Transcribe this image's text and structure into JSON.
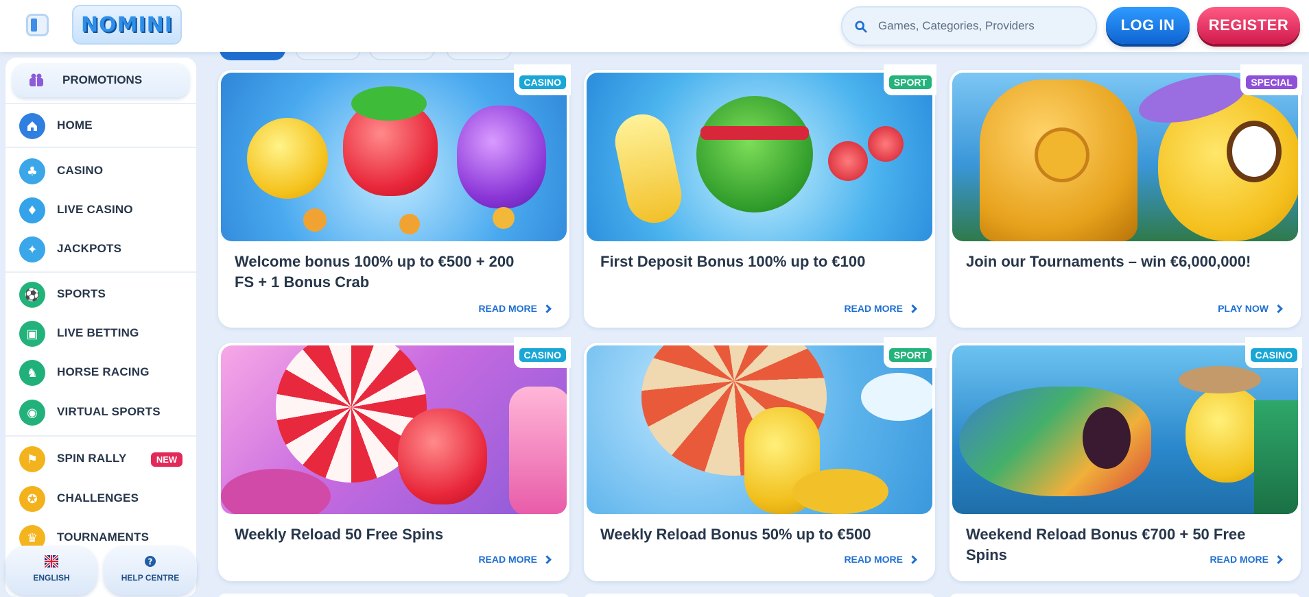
{
  "header": {
    "logo_text": "NOMINI",
    "search_placeholder": "Games, Categories, Providers",
    "login_label": "LOG IN",
    "register_label": "REGISTER"
  },
  "sidebar": {
    "promotions_label": "PROMOTIONS",
    "items": [
      {
        "label": "HOME",
        "icon": "home-icon",
        "color": "#2f7fe0"
      },
      {
        "label": "CASINO",
        "icon": "cards-icon",
        "color": "#3ba6e8"
      },
      {
        "label": "LIVE CASINO",
        "icon": "live-casino-icon",
        "color": "#35a3ea"
      },
      {
        "label": "JACKPOTS",
        "icon": "jackpot-icon",
        "color": "#3aa7ea"
      },
      {
        "label": "SPORTS",
        "icon": "soccer-ball-icon",
        "color": "#22b37a"
      },
      {
        "label": "LIVE BETTING",
        "icon": "live-betting-icon",
        "color": "#24b27c"
      },
      {
        "label": "HORSE RACING",
        "icon": "horse-icon",
        "color": "#20b07a"
      },
      {
        "label": "VIRTUAL SPORTS",
        "icon": "virtual-sports-icon",
        "color": "#23b17b"
      },
      {
        "label": "SPIN RALLY",
        "icon": "spin-rally-icon",
        "color": "#f2b31d",
        "badge": "NEW"
      },
      {
        "label": "CHALLENGES",
        "icon": "medal-icon",
        "color": "#f3b21c"
      },
      {
        "label": "TOURNAMENTS",
        "icon": "trophy-icon",
        "color": "#f4b41e"
      }
    ],
    "footer": {
      "language_label": "ENGLISH",
      "help_label": "HELP CENTRE"
    }
  },
  "promotions": [
    {
      "tag": "CASINO",
      "tag_color": "#1aa7d6",
      "title": "Welcome bonus 100% up to €500 + 200 FS + 1 Bonus Crab",
      "cta": "READ MORE"
    },
    {
      "tag": "SPORT",
      "tag_color": "#23b37b",
      "title": "First Deposit Bonus 100% up to €100",
      "cta": "READ MORE"
    },
    {
      "tag": "SPECIAL",
      "tag_color": "#8e4fd9",
      "title": "Join our Tournaments – win €6,000,000!",
      "cta": "PLAY NOW"
    },
    {
      "tag": "CASINO",
      "tag_color": "#1aa7d6",
      "title": "Weekly Reload 50 Free Spins",
      "cta": "READ MORE"
    },
    {
      "tag": "SPORT",
      "tag_color": "#23b37b",
      "title": "Weekly Reload Bonus 50% up to €500",
      "cta": "READ MORE"
    },
    {
      "tag": "CASINO",
      "tag_color": "#1aa7d6",
      "title": "Weekend Reload Bonus €700 + 50 Free Spins",
      "cta": "READ MORE"
    }
  ]
}
